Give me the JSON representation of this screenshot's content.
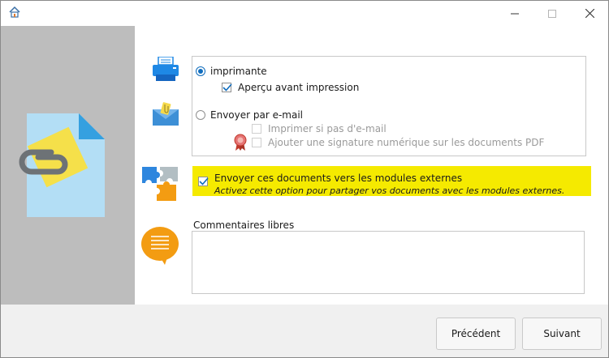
{
  "titlebar": {
    "icons": {
      "app": "home-icon",
      "minimize": "minimize-icon",
      "maximize": "maximize-icon",
      "close": "close-icon"
    }
  },
  "output": {
    "printer_label": "imprimante",
    "preview_label": "Aperçu avant impression",
    "email_label": "Envoyer par e-mail",
    "print_if_no_email_label": "Imprimer si pas d'e-mail",
    "digital_signature_label": "Ajouter une signature numérique sur les documents PDF",
    "printer_selected": true,
    "preview_checked": true
  },
  "external_modules": {
    "title": "Envoyer ces documents vers les modules externes",
    "description": "Activez cette option pour partager vos documents avec les modules externes.",
    "checked": true,
    "highlight_color": "#f5ea00"
  },
  "comments": {
    "label": "Commentaires libres",
    "value": ""
  },
  "buttons": {
    "previous": "Précédent",
    "next": "Suivant"
  },
  "colors": {
    "accent": "#0f6cbd",
    "side_panel": "#bdbdbd",
    "print_icon_blue": "#1e88e5",
    "comment_icon_orange": "#f39c12"
  }
}
